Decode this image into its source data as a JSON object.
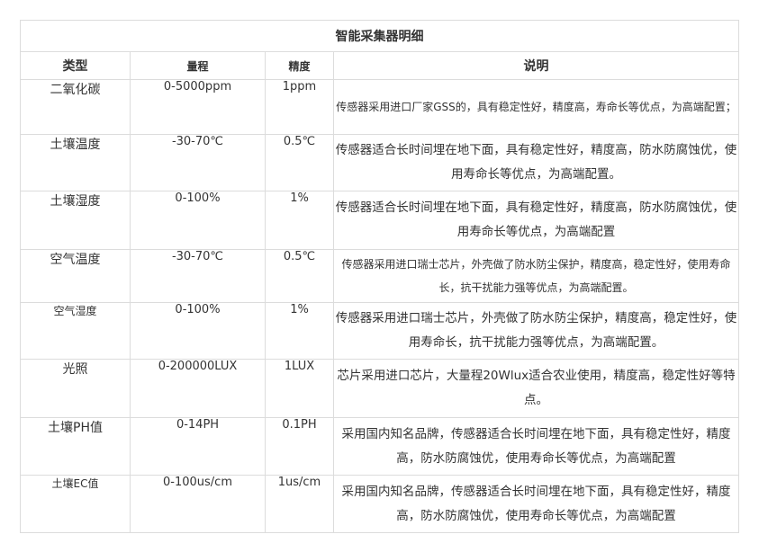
{
  "table": {
    "title": "智能采集器明细",
    "headers": {
      "type": "类型",
      "range": "量程",
      "precision": "精度",
      "description": "说明"
    },
    "rows": [
      {
        "type": "二氧化碳",
        "range": "0-5000ppm",
        "precision": "1ppm",
        "description": "传感器采用进口厂家GSS的，具有稳定性好，精度高，寿命长等优点，为高端配置；"
      },
      {
        "type": "土壤温度",
        "range": "-30-70℃",
        "precision": "0.5℃",
        "description": "传感器适合长时间埋在地下面，具有稳定性好，精度高，防水防腐蚀优，使用寿命长等优点，为高端配置。"
      },
      {
        "type": "土壤湿度",
        "range": "0-100%",
        "precision": "1%",
        "description": "传感器适合长时间埋在地下面，具有稳定性好，精度高，防水防腐蚀优，使用寿命长等优点，为高端配置"
      },
      {
        "type": "空气温度",
        "range": "-30-70℃",
        "precision": "0.5℃",
        "description": "传感器采用进口瑞士芯片，外壳做了防水防尘保护，精度高，稳定性好，使用寿命长，抗干扰能力强等优点，为高端配置。"
      },
      {
        "type": "空气湿度",
        "range": "0-100%",
        "precision": "1%",
        "description": "传感器采用进口瑞士芯片，外壳做了防水防尘保护，精度高，稳定性好，使用寿命长，抗干扰能力强等优点，为高端配置。"
      },
      {
        "type": "光照",
        "range": "0-200000LUX",
        "precision": "1LUX",
        "description": "芯片采用进口芯片，大量程20Wlux适合农业使用，精度高，稳定性好等特点。"
      },
      {
        "type": "土壤PH值",
        "range": "0-14PH",
        "precision": "0.1PH",
        "description": "采用国内知名品牌，传感器适合长时间埋在地下面，具有稳定性好，精度高，防水防腐蚀优，使用寿命长等优点，为高端配置"
      },
      {
        "type": "土壤EC值",
        "range": "0-100us/cm",
        "precision": "1us/cm",
        "description": "采用国内知名品牌，传感器适合长时间埋在地下面，具有稳定性好，精度高，防水防腐蚀优，使用寿命长等优点，为高端配置"
      }
    ]
  }
}
